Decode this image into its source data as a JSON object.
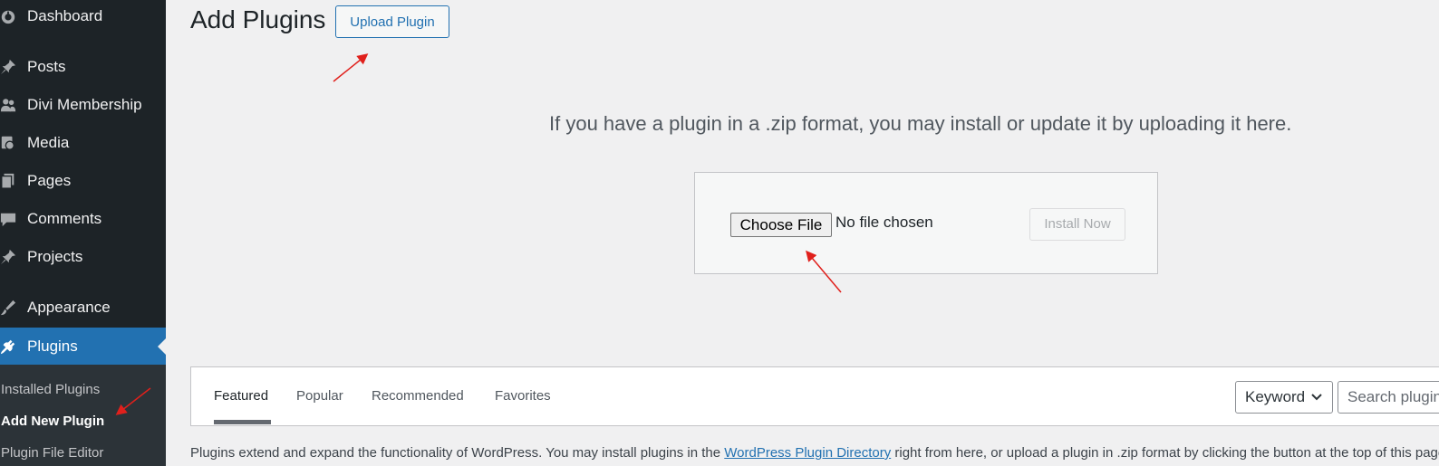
{
  "sidebar": {
    "items": [
      {
        "label": "Dashboard",
        "icon": "dashboard-icon"
      },
      {
        "label": "Posts",
        "icon": "pin-icon"
      },
      {
        "label": "Divi Membership",
        "icon": "users-icon"
      },
      {
        "label": "Media",
        "icon": "media-icon"
      },
      {
        "label": "Pages",
        "icon": "pages-icon"
      },
      {
        "label": "Comments",
        "icon": "comment-icon"
      },
      {
        "label": "Projects",
        "icon": "pin-icon"
      },
      {
        "label": "Appearance",
        "icon": "brush-icon"
      },
      {
        "label": "Plugins",
        "icon": "plug-icon",
        "active": true
      }
    ],
    "submenu": [
      "Installed Plugins",
      "Add New Plugin",
      "Plugin File Editor"
    ]
  },
  "header": {
    "title": "Add Plugins",
    "upload_button": "Upload Plugin"
  },
  "upload": {
    "help_text": "If you have a plugin in a .zip format, you may install or update it by uploading it here.",
    "choose_file": "Choose File",
    "no_file": "No file chosen",
    "install_button": "Install Now"
  },
  "filters": {
    "tabs": [
      "Featured",
      "Popular",
      "Recommended",
      "Favorites"
    ],
    "keyword": "Keyword",
    "search_placeholder": "Search plugins..."
  },
  "intro": {
    "before_link": "Plugins extend and expand the functionality of WordPress. You may install plugins in the ",
    "link": "WordPress Plugin Directory",
    "after_link": " right from here, or upload a plugin in .zip format by clicking the button at the top of this page."
  },
  "colors": {
    "sidebar_bg": "#1d2327",
    "accent": "#2271b1",
    "annotation_arrow": "#e0201c"
  }
}
